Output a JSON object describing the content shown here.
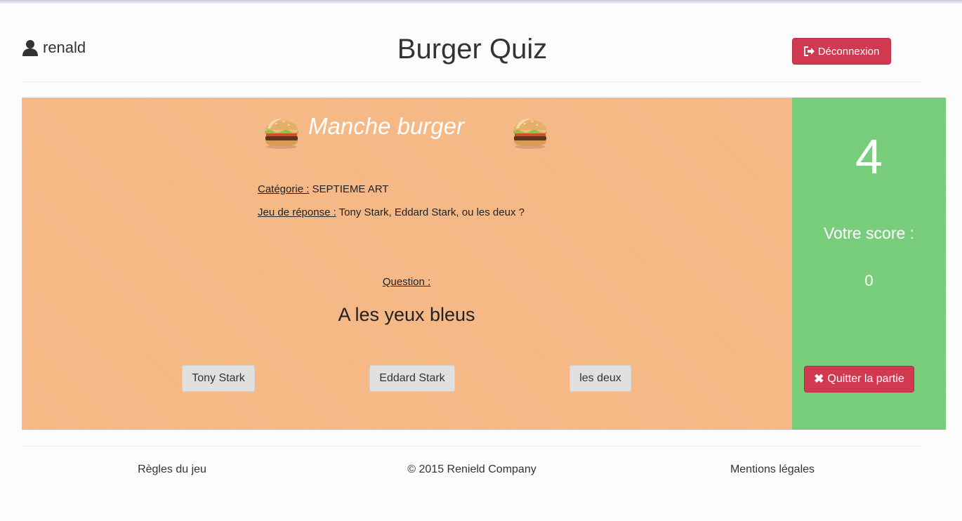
{
  "header": {
    "username": "renald",
    "title": "Burger Quiz",
    "logout_label": "Déconnexion",
    "icons": {
      "user": "user-icon",
      "logout": "sign-out-icon"
    }
  },
  "round": {
    "title": "Manche burger",
    "icon": "burger-icon",
    "category_label": "Catégorie :",
    "category_value": "SEPTIEME ART",
    "answerset_label": "Jeu de réponse :",
    "answerset_value": "Tony Stark, Eddard Stark, ou les deux ?",
    "question_label": "Question :",
    "question_text": "A les yeux bleus",
    "answers": [
      "Tony Stark",
      "Eddard Stark",
      "les deux"
    ]
  },
  "score_panel": {
    "timer": "4",
    "score_label": "Votre score :",
    "score_value": "0",
    "quit_label": "Quitter la partie",
    "quit_icon": "close-icon"
  },
  "footer": {
    "rules": "Règles du jeu",
    "copyright": "© 2015 Renield Company",
    "legal": "Mentions légales"
  },
  "colors": {
    "round_panel": "#f5b784",
    "score_panel": "#76cc78",
    "danger": "#d0394f",
    "answer_button": "#e0e0e0"
  }
}
